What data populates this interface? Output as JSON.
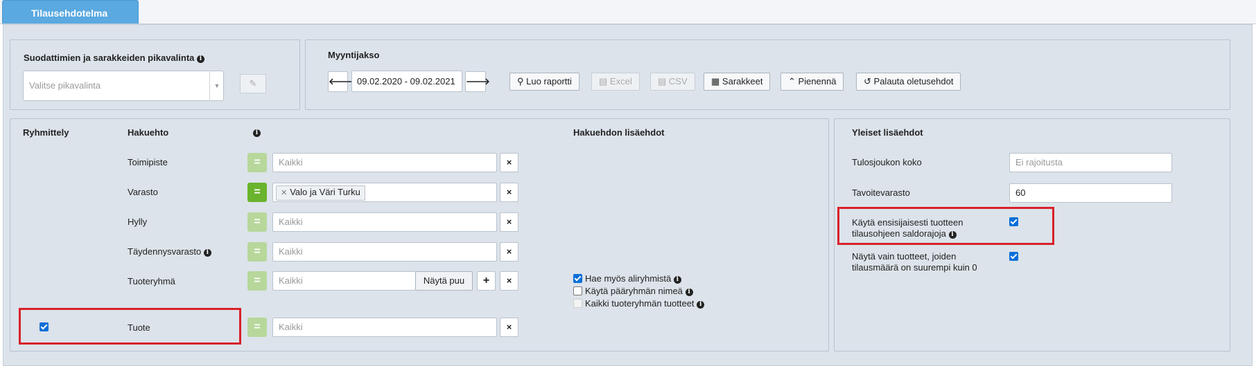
{
  "tab": {
    "title": "Tilausehdotelma"
  },
  "quick": {
    "title": "Suodattimien ja sarakkeiden pikavalinta",
    "placeholder": "Valitse pikavalinta"
  },
  "period": {
    "title": "Myyntijakso",
    "range": "09.02.2020 - 09.02.2021",
    "buttons": {
      "create": "Luo raportti",
      "excel": "Excel",
      "csv": "CSV",
      "columns": "Sarakkeet",
      "minimize": "Pienennä",
      "reset": "Palauta oletusehdot"
    }
  },
  "filters": {
    "headers": {
      "grouping": "Ryhmittely",
      "criterion": "Hakuehto",
      "extra": "Hakuehdon lisäehdot"
    },
    "rows": [
      {
        "label": "Toimipiste",
        "placeholder": "Kaikki"
      },
      {
        "label": "Varasto",
        "chip": "Valo ja Väri Turku"
      },
      {
        "label": "Hylly",
        "placeholder": "Kaikki"
      },
      {
        "label": "Täydennysvarasto",
        "placeholder": "Kaikki"
      },
      {
        "label": "Tuoteryhmä",
        "placeholder": "Kaikki",
        "tree_button": "Näytä puu"
      },
      {
        "label": "Tuote",
        "placeholder": "Kaikki"
      }
    ],
    "eq_symbol": "=",
    "clear_symbol": "×",
    "add_symbol": "+",
    "group_options": [
      {
        "label": "Hae myös aliryhmistä",
        "checked": true
      },
      {
        "label": "Käytä pääryhmän nimeä",
        "checked": false
      },
      {
        "label": "Kaikki tuoteryhmän tuotteet",
        "checked": false
      }
    ]
  },
  "general": {
    "title": "Yleiset lisäehdot",
    "result_size_label": "Tulosjoukon koko",
    "result_size_placeholder": "Ei rajoitusta",
    "target_stock_label": "Tavoitevarasto",
    "target_stock_value": "60",
    "primary_limits_line1": "Käytä ensisijaisesti tuotteen",
    "primary_limits_line2": "tilausohjeen saldorajoja",
    "only_positive_line1": "Näytä vain tuotteet, joiden",
    "only_positive_line2": "tilausmäärä on suurempi kuin 0"
  },
  "colors": {
    "accent": "#5aa9e0",
    "highlight": "#d9202a",
    "eq_on": "#6ab42d",
    "eq_off": "#b7d79b"
  }
}
